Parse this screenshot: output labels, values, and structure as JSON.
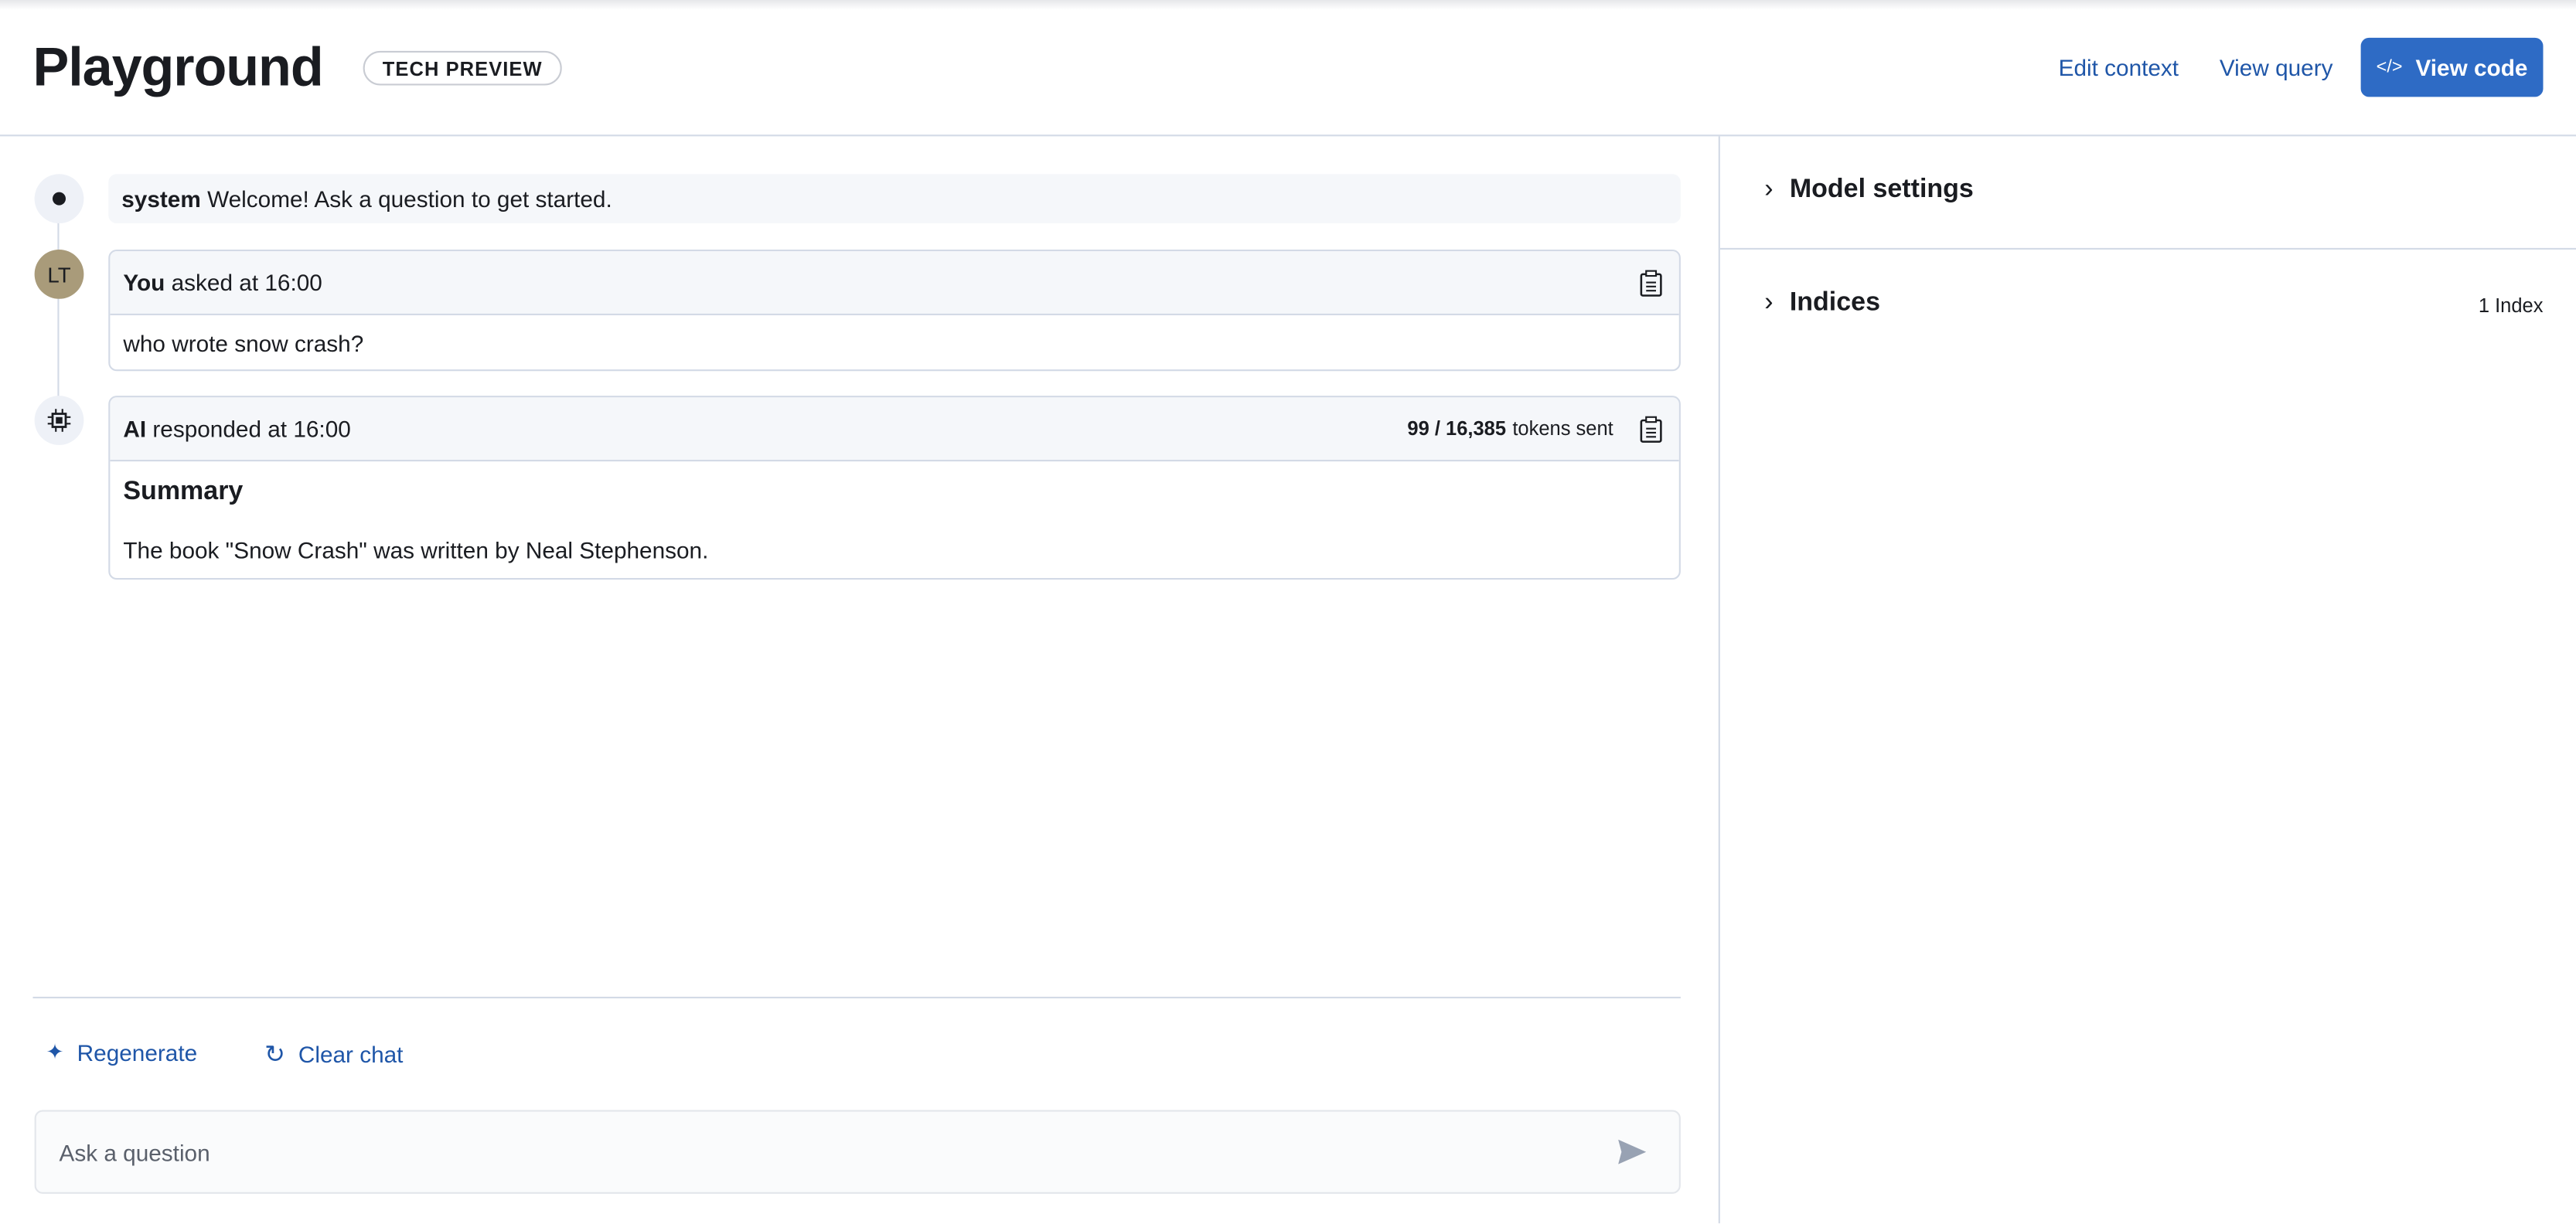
{
  "header": {
    "title": "Playground",
    "badge": "TECH PREVIEW",
    "edit_context": "Edit context",
    "view_query": "View query",
    "view_code": "View code"
  },
  "chat": {
    "system": {
      "role": "system",
      "text": "Welcome! Ask a question to get started."
    },
    "user": {
      "avatar": "LT",
      "who": "You",
      "meta": "asked at 16:00",
      "text": "who wrote snow crash?"
    },
    "ai": {
      "who": "AI",
      "meta": "responded at 16:00",
      "tokens": "99 / 16,385",
      "tokens_suffix": "tokens sent",
      "heading": "Summary",
      "text": "The book \"Snow Crash\" was written by Neal Stephenson."
    }
  },
  "actions": {
    "regenerate": "Regenerate",
    "clear": "Clear chat"
  },
  "input": {
    "placeholder": "Ask a question"
  },
  "sidebar": {
    "model_settings": "Model settings",
    "indices": "Indices",
    "indices_count": "1 Index"
  },
  "colors": {
    "accent": "#2e6bc5",
    "link": "#1f56a8",
    "avatar": "#a99b7a"
  }
}
